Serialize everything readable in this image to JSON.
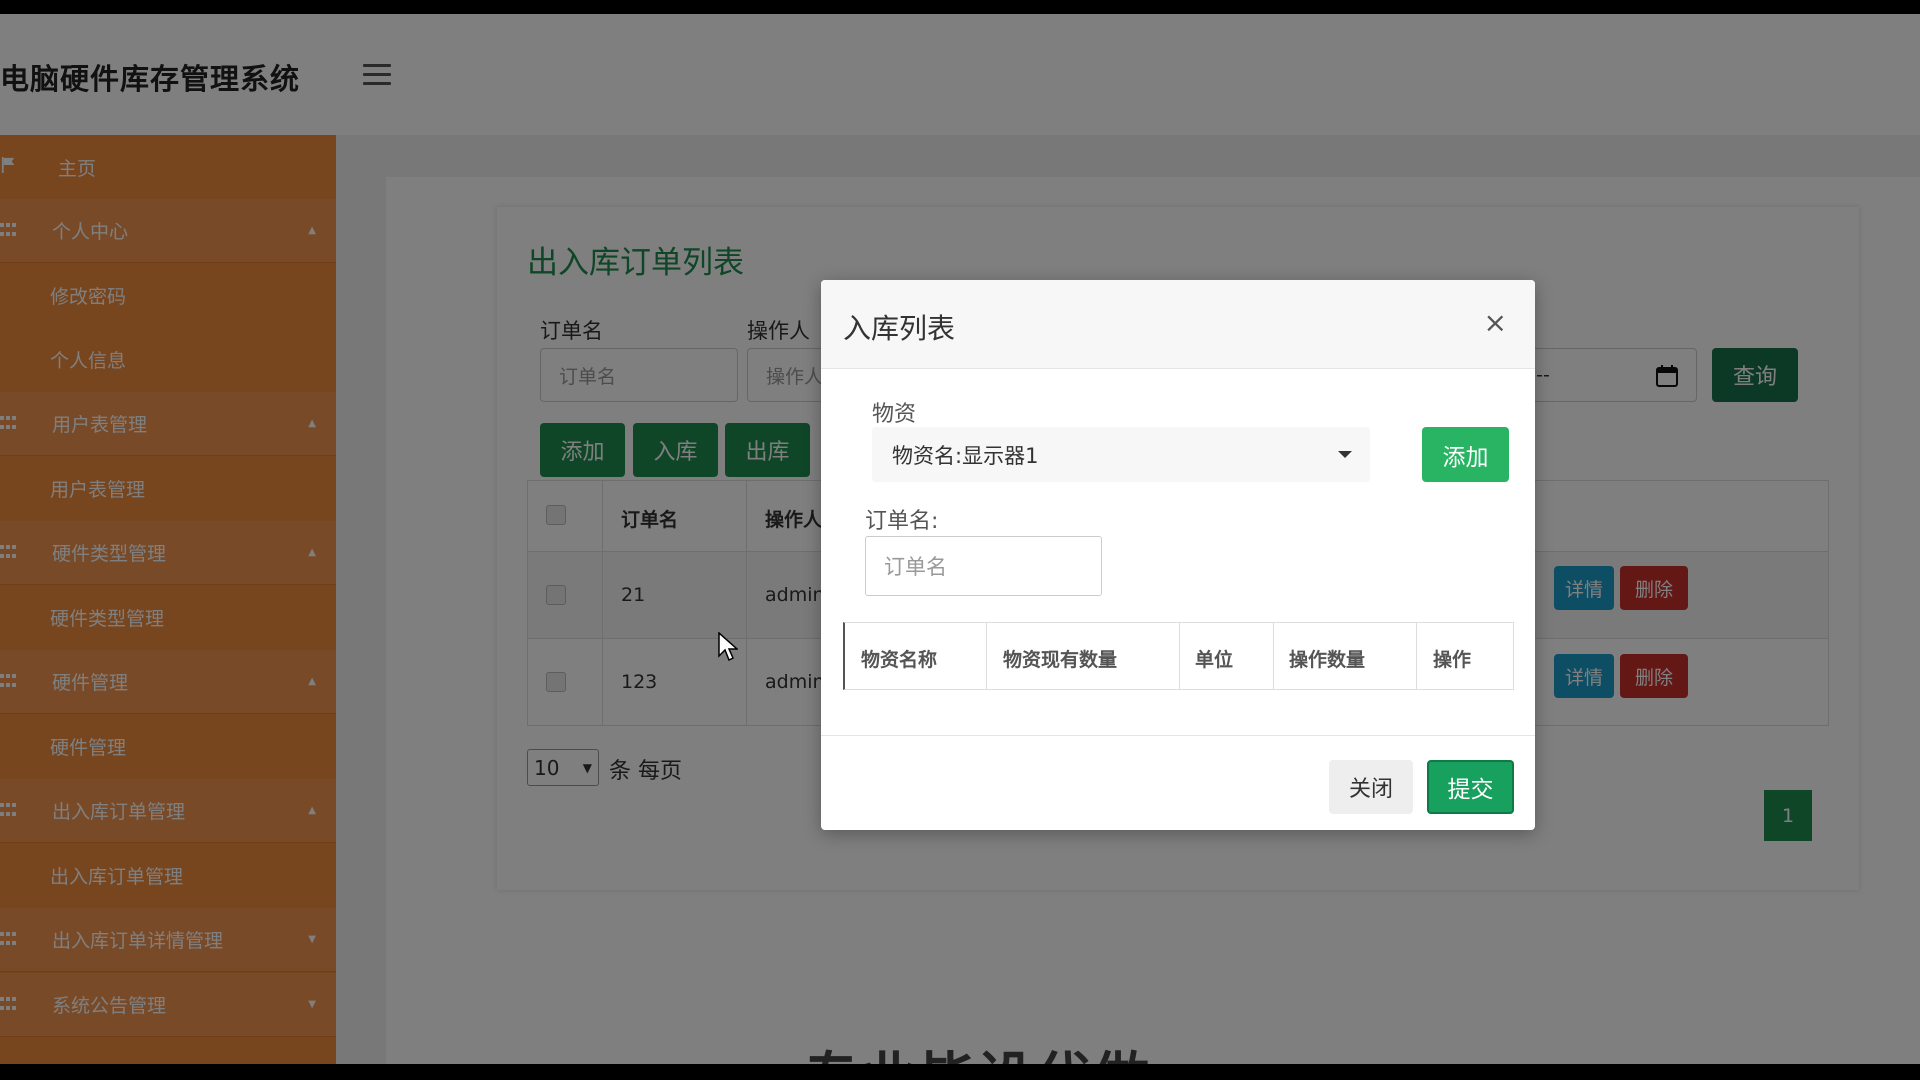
{
  "header": {
    "app_title": "电脑硬件库存管理系统",
    "menu_icon": "hamburger-icon"
  },
  "sidebar": {
    "items": [
      {
        "label": "主页",
        "icon": "flag-icon",
        "type": "home"
      },
      {
        "label": "个人中心",
        "icon": "grid-icon",
        "type": "parent",
        "caret": "up"
      },
      {
        "label": "修改密码",
        "type": "child"
      },
      {
        "label": "个人信息",
        "type": "child"
      },
      {
        "label": "用户表管理",
        "icon": "grid-icon",
        "type": "parent",
        "caret": "up"
      },
      {
        "label": "用户表管理",
        "type": "child"
      },
      {
        "label": "硬件类型管理",
        "icon": "grid-icon",
        "type": "parent",
        "caret": "up"
      },
      {
        "label": "硬件类型管理",
        "type": "child"
      },
      {
        "label": "硬件管理",
        "icon": "grid-icon",
        "type": "parent",
        "caret": "up"
      },
      {
        "label": "硬件管理",
        "type": "child"
      },
      {
        "label": "出入库订单管理",
        "icon": "grid-icon",
        "type": "parent",
        "caret": "up"
      },
      {
        "label": "出入库订单管理",
        "type": "child"
      },
      {
        "label": "出入库订单详情管理",
        "icon": "grid-icon",
        "type": "parent",
        "caret": "down"
      },
      {
        "label": "系统公告管理",
        "icon": "grid-icon",
        "type": "parent",
        "caret": "down"
      }
    ]
  },
  "main": {
    "page_title": "出入库订单列表",
    "filters": {
      "order_name_label": "订单名",
      "order_name_placeholder": "订单名",
      "operator_label": "操作人",
      "operator_placeholder": "操作人",
      "date_partial": "--:--",
      "query_button": "查询"
    },
    "toolbar": {
      "add": "添加",
      "in_stock": "入库",
      "out_stock": "出库"
    },
    "table": {
      "headers": [
        "订单名",
        "操作人"
      ],
      "rows": [
        {
          "order_name": "21",
          "operator": "admin",
          "detail": "详情",
          "delete": "删除"
        },
        {
          "order_name": "123",
          "operator": "admin",
          "detail": "详情",
          "delete": "删除"
        }
      ]
    },
    "pagination": {
      "page_size": "10",
      "page_size_suffix": "条 每页",
      "current_page": "1"
    }
  },
  "modal": {
    "title": "入库列表",
    "close_symbol": "×",
    "material_label": "物资",
    "material_selected": "物资名:显示器1",
    "add_button": "添加",
    "order_name_label": "订单名:",
    "order_name_placeholder": "订单名",
    "table_headers": [
      "物资名称",
      "物资现有数量",
      "单位",
      "操作数量",
      "操作"
    ],
    "close_button": "关闭",
    "submit_button": "提交"
  },
  "bottom_caption": "专业毕设代做",
  "colors": {
    "sidebar": "#ef8a3c",
    "primary_green": "#1e8c4e",
    "danger": "#c9302c",
    "info": "#1a9cc9"
  }
}
